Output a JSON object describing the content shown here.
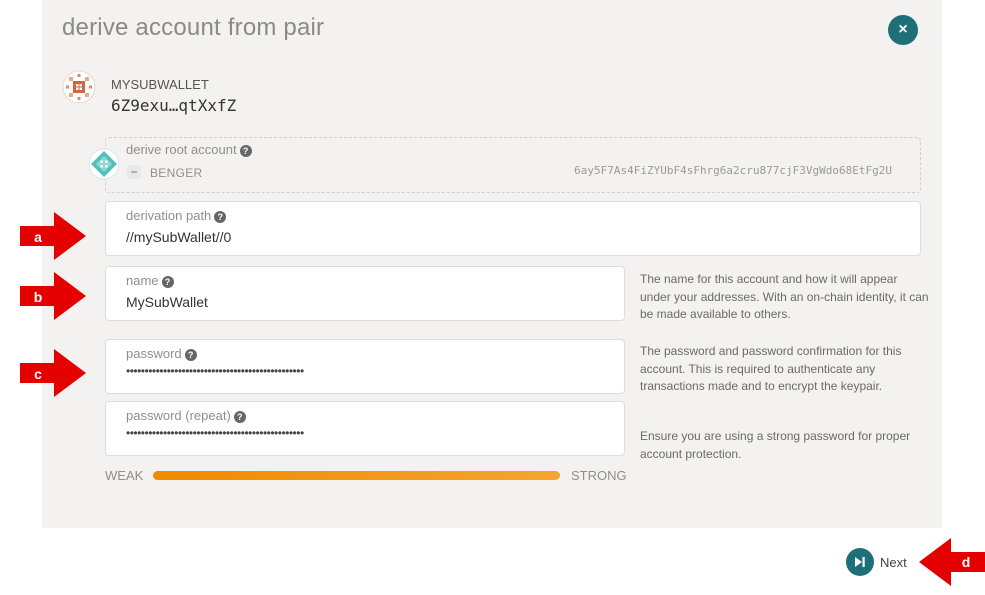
{
  "modal": {
    "title": "derive account from pair",
    "close_symbol": "×"
  },
  "source_account": {
    "name": "MYSUBWALLET",
    "address": "6Z9exu…qtXxfZ"
  },
  "root": {
    "label": "derive root account",
    "network": "BENGER",
    "address": "6ay5F7As4FiZYUbF4sFhrg6a2cru877cjF3VgWdo68EtFg2U"
  },
  "fields": {
    "derivation_path": {
      "label": "derivation path",
      "value": "//mySubWallet//0"
    },
    "name": {
      "label": "name",
      "value": "MySubWallet"
    },
    "password": {
      "label": "password",
      "value": "••••••••••••••••••••••••••••••••••••••••••••••••"
    },
    "password_repeat": {
      "label": "password (repeat)",
      "value": "••••••••••••••••••••••••••••••••••••••••••••••••"
    }
  },
  "help": {
    "name": "The name for this account and how it will appear under your addresses. With an on-chain identity, it can be made available to others.",
    "password_1": "The password and password confirmation for this account. This is required to authenticate any transactions made and to encrypt the keypair.",
    "password_2": "Ensure you are using a strong password for proper account protection."
  },
  "strength": {
    "weak_label": "WEAK",
    "strong_label": "STRONG",
    "level": 1.0,
    "color": "#f39200"
  },
  "next_button": {
    "label": "Next"
  },
  "annotations": {
    "a": "a",
    "b": "b",
    "c": "c",
    "d": "d"
  },
  "colors": {
    "accent": "#1e6f78",
    "arrow": "#e50000",
    "modal_bg": "#f3f2f1"
  },
  "icons": {
    "close": "close-icon",
    "help": "question-circle-icon",
    "next": "skip-forward-icon",
    "account": "identicon",
    "root": "identicon",
    "collapse": "minus-icon"
  }
}
